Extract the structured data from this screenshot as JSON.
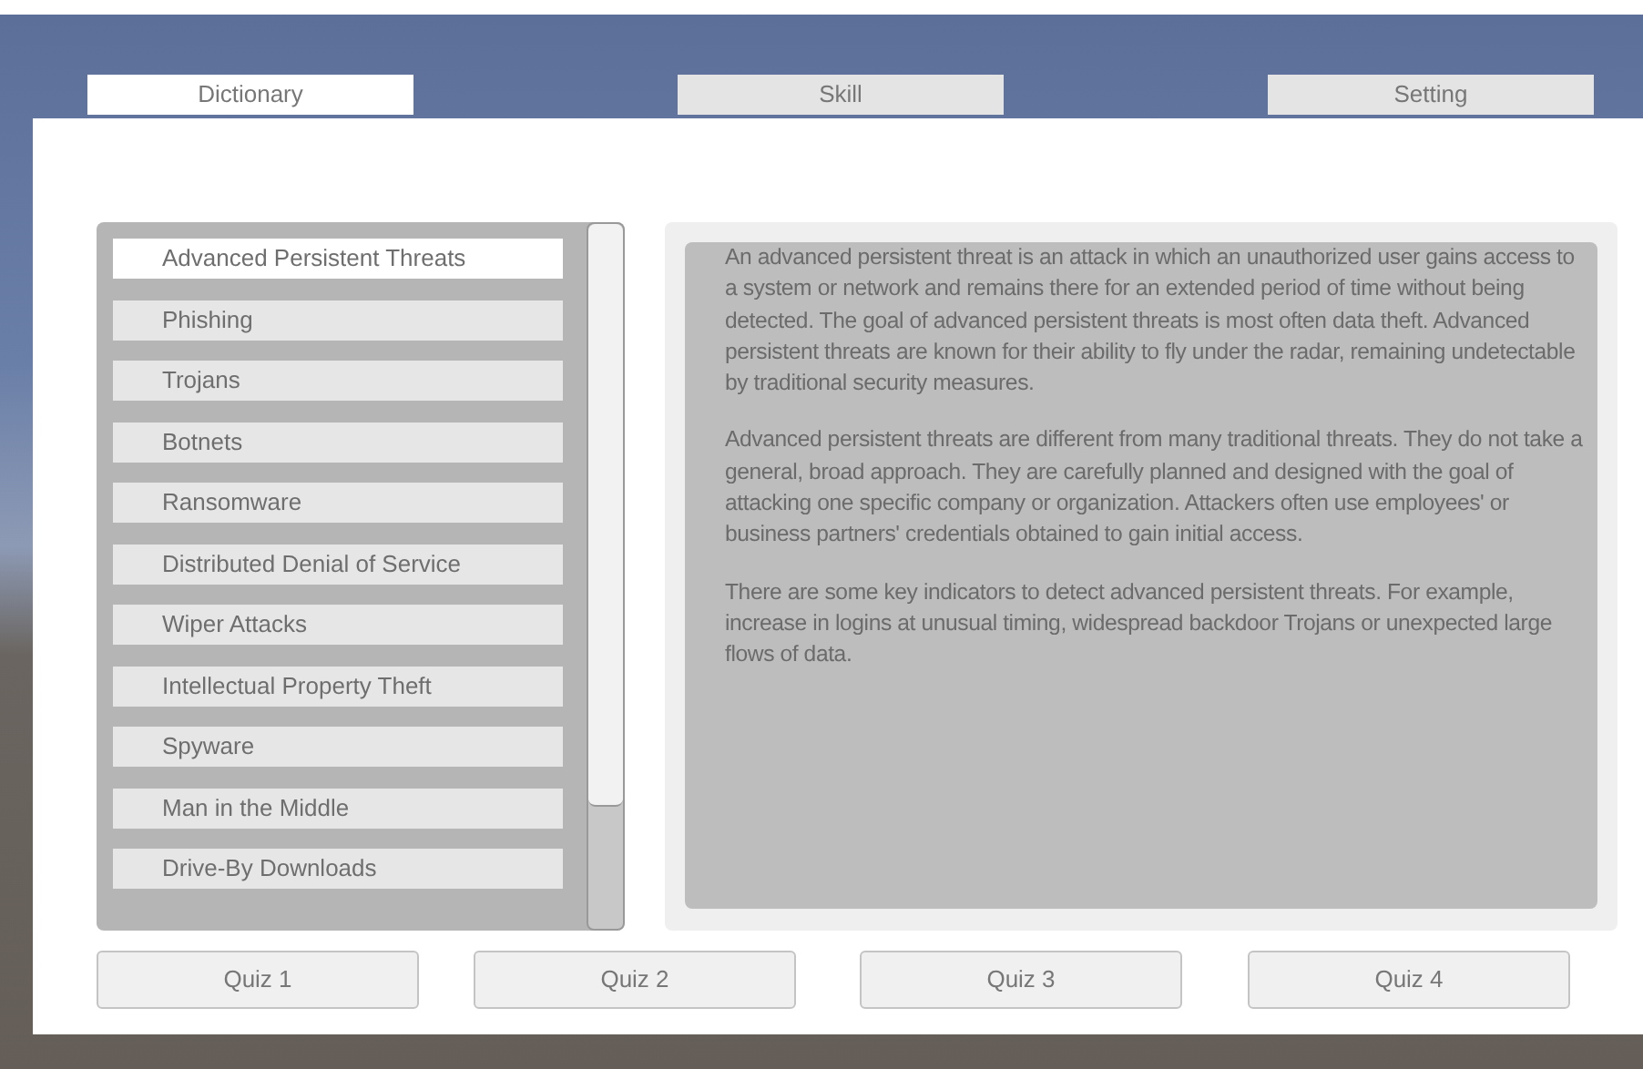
{
  "tabs": [
    {
      "label": "Dictionary",
      "selected": true
    },
    {
      "label": "Skill",
      "selected": false
    },
    {
      "label": "Setting",
      "selected": false
    }
  ],
  "topics": [
    {
      "label": "Advanced Persistent Threats",
      "selected": true
    },
    {
      "label": "Phishing",
      "selected": false
    },
    {
      "label": "Trojans",
      "selected": false
    },
    {
      "label": "Botnets",
      "selected": false
    },
    {
      "label": "Ransomware",
      "selected": false
    },
    {
      "label": "Distributed Denial of Service",
      "selected": false
    },
    {
      "label": "Wiper Attacks",
      "selected": false
    },
    {
      "label": "Intellectual Property Theft",
      "selected": false
    },
    {
      "label": "Spyware",
      "selected": false
    },
    {
      "label": "Man in the Middle",
      "selected": false
    },
    {
      "label": "Drive-By Downloads",
      "selected": false
    }
  ],
  "description": [
    "An advanced persistent threat is an attack in which an unauthorized user gains access to a system or network and remains there for an extended period of time without being detected. The goal of advanced persistent threats is most often data theft. Advanced persistent threats are known for their ability to fly under the radar, remaining undetectable by traditional security measures.",
    "Advanced persistent threats are different from many traditional threats. They do not take a general, broad approach. They are carefully planned and designed with the goal of attacking one specific company or organization. Attackers often use employees' or business partners' credentials obtained to gain initial access.",
    "There are some key indicators to detect advanced persistent threats. For example, increase in logins at unusual timing, widespread backdoor Trojans or unexpected large flows of data."
  ],
  "quiz_buttons": [
    "Quiz 1",
    "Quiz 2",
    "Quiz 3",
    "Quiz 4"
  ]
}
